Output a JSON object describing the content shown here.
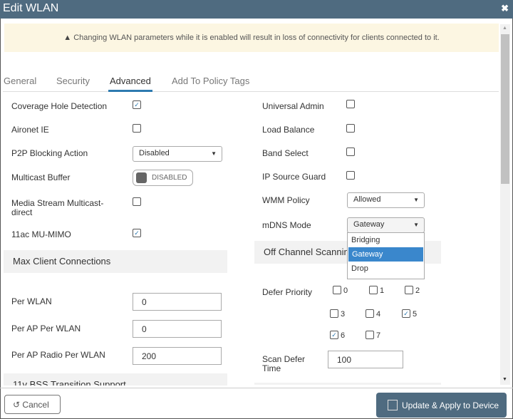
{
  "dialog": {
    "title": "Edit WLAN",
    "close_icon": "close-icon"
  },
  "warning": {
    "icon": "warning-icon",
    "text": "Changing WLAN parameters while it is enabled will result in loss of connectivity for clients connected to it."
  },
  "tabs": [
    {
      "label": "General"
    },
    {
      "label": "Security"
    },
    {
      "label": "Advanced",
      "active": true
    },
    {
      "label": "Add To Policy Tags"
    }
  ],
  "left": {
    "coverage_hole_detection": {
      "label": "Coverage Hole Detection",
      "checked": true
    },
    "aironet_ie": {
      "label": "Aironet IE",
      "checked": false
    },
    "p2p_blocking": {
      "label": "P2P Blocking Action",
      "value": "Disabled"
    },
    "multicast_buffer": {
      "label": "Multicast Buffer",
      "value": "DISABLED"
    },
    "media_stream": {
      "label": "Media Stream Multicast-direct",
      "checked": false
    },
    "mu_mimo": {
      "label": "11ac MU-MIMO",
      "checked": true
    },
    "max_client": {
      "title": "Max Client Connections",
      "per_wlan": {
        "label": "Per WLAN",
        "value": "0"
      },
      "per_ap_per_wlan": {
        "label": "Per AP Per WLAN",
        "value": "0"
      },
      "per_ap_radio": {
        "label": "Per AP Radio Per WLAN",
        "value": "200"
      }
    },
    "bss_section": "11v BSS Transition Support"
  },
  "right": {
    "universal_admin": {
      "label": "Universal Admin",
      "checked": false
    },
    "load_balance": {
      "label": "Load Balance",
      "checked": false
    },
    "band_select": {
      "label": "Band Select",
      "checked": false
    },
    "ip_source_guard": {
      "label": "IP Source Guard",
      "checked": false
    },
    "wmm_policy": {
      "label": "WMM Policy",
      "value": "Allowed"
    },
    "mdns_mode": {
      "label": "mDNS Mode",
      "value": "Gateway",
      "options": [
        "Bridging",
        "Gateway",
        "Drop"
      ],
      "highlighted": "Gateway"
    },
    "off_channel": {
      "title": "Off Channel Scanning"
    },
    "defer_priority": {
      "label": "Defer Priority",
      "items": [
        {
          "n": "0",
          "checked": false
        },
        {
          "n": "1",
          "checked": false
        },
        {
          "n": "2",
          "checked": false
        },
        {
          "n": "3",
          "checked": false
        },
        {
          "n": "4",
          "checked": false
        },
        {
          "n": "5",
          "checked": true
        },
        {
          "n": "6",
          "checked": true
        },
        {
          "n": "7",
          "checked": false
        }
      ]
    },
    "scan_defer_time": {
      "label": "Scan Defer Time",
      "value": "100"
    }
  },
  "footer": {
    "cancel": "Cancel",
    "update": "Update & Apply to Device"
  },
  "colors": {
    "titlebar": "#4f6b80",
    "accent": "#2d7ab0",
    "highlight": "#3a87cc",
    "warning_bg": "#fcf6e2"
  }
}
